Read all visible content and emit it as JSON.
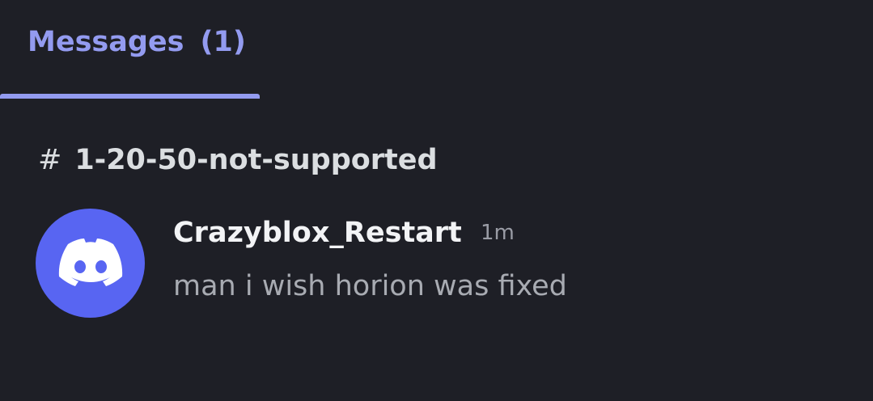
{
  "tab": {
    "label": "Messages",
    "count": "(1)"
  },
  "channel": {
    "hash": "#",
    "name": "1-20-50-not-supported"
  },
  "message": {
    "avatar_icon": "discord-logo-icon",
    "author": "Crazyblox_Restart",
    "time": "1m",
    "text": "man i wish horion was fixed"
  },
  "colors": {
    "background": "#1e1f26",
    "accent": "#939bf0",
    "avatar_bg": "#5865f2"
  }
}
